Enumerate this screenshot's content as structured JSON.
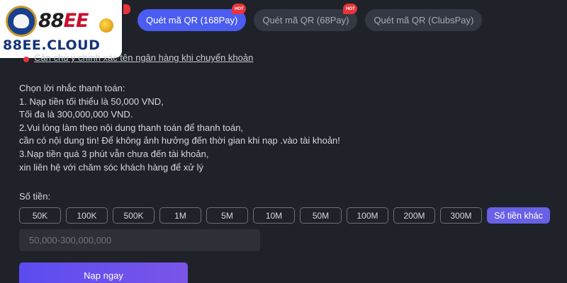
{
  "logo": {
    "word_prefix": "88",
    "word_suffix": "EE",
    "domain": "88EE.CLOUD"
  },
  "tabs": [
    {
      "label": "Quét mã QR (168Pay)",
      "active": true,
      "hot": "HOT"
    },
    {
      "label": "Quét mã QR (68Pay)",
      "active": false,
      "hot": "HOT"
    },
    {
      "label": "Quét mã QR (ClubsPay)",
      "active": false,
      "hot": ""
    }
  ],
  "top_link": "Cần chú ý chính xác tên ngân hàng khi chuyển khoản",
  "notes": [
    "Chọn lời nhắc thanh toán:",
    "1. Nạp tiền tối thiểu là 50,000 VND,",
    "Tối đa là 300,000,000 VND.",
    "2.Vui lòng làm theo nội dung thanh toán để thanh toán,",
    "cần có nội dung tin! Để không ảnh hưởng đến thời gian khi nạp .vào tài khoản!",
    "3.Nạp tiền quá 3 phút vẫn chưa đến tài khoản,",
    "xin liên hệ với chăm sóc khách hàng để xử lý"
  ],
  "amount": {
    "label": "Số tiền:",
    "options": [
      "50K",
      "100K",
      "500K",
      "1M",
      "5M",
      "10M",
      "50M",
      "100M",
      "200M",
      "300M"
    ],
    "other_label": "Số tiền khác",
    "placeholder": "50,000-300,000,000"
  },
  "submit_label": "Nạp ngay",
  "colors": {
    "accent": "#4b5cf0",
    "button": "#6a60e6",
    "hot": "#e8333c",
    "background": "#1f2229"
  }
}
